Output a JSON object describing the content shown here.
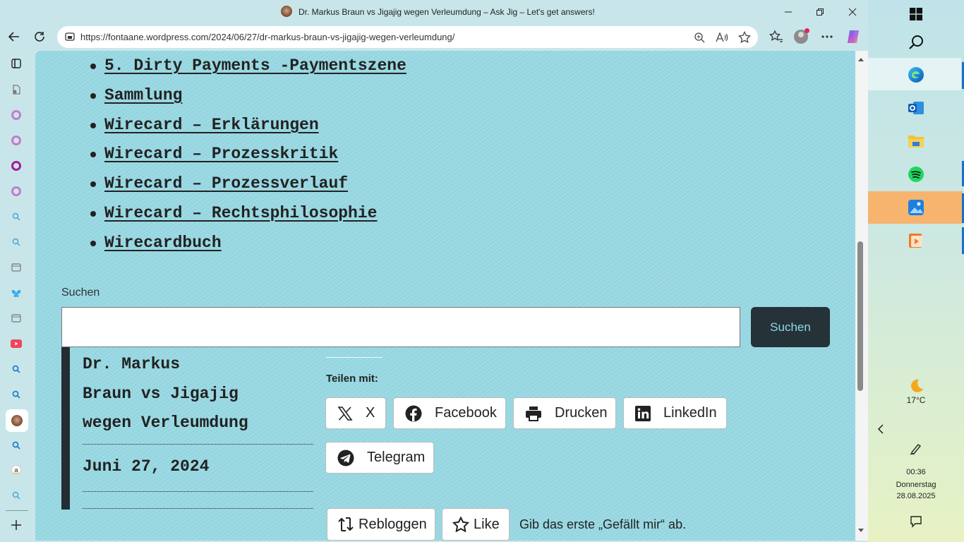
{
  "window": {
    "title": "Dr. Markus Braun vs Jigajig wegen Verleumdung – Ask Jig – Let's get answers!"
  },
  "address_bar": {
    "url": "https://fontaane.wordpress.com/2024/06/27/dr-markus-braun-vs-jigajig-wegen-verleumdung/"
  },
  "categories": [
    "5. Dirty Payments -Paymentszene",
    "Sammlung",
    "Wirecard – Erklärungen",
    "Wirecard – Prozesskritik",
    "Wirecard – Prozessverlauf",
    "Wirecard – Rechtsphilosophie",
    "Wirecardbuch"
  ],
  "search": {
    "label": "Suchen",
    "value": "",
    "button_label": "Suchen"
  },
  "post": {
    "title_lines": [
      "Dr. Markus",
      "Braun vs Jigajig",
      "wegen Verleumdung"
    ],
    "date": "Juni 27, 2024"
  },
  "share": {
    "heading": "Teilen mit:",
    "buttons": [
      {
        "label": "X",
        "icon": "x-logo-icon"
      },
      {
        "label": "Facebook",
        "icon": "facebook-icon"
      },
      {
        "label": "Drucken",
        "icon": "printer-icon"
      },
      {
        "label": "LinkedIn",
        "icon": "linkedin-icon"
      },
      {
        "label": "Telegram",
        "icon": "telegram-icon"
      }
    ]
  },
  "actions": {
    "reblog_label": "Rebloggen",
    "like_label": "Like",
    "like_text": "Gib das erste „Gefällt mir“ ab."
  },
  "taskbar": {
    "weather_temp": "17°C",
    "time": "00:36",
    "day": "Donnerstag",
    "date": "28.08.2025"
  },
  "colors": {
    "page_background": "#98d8e2",
    "chrome_background": "#c8e6ea",
    "search_button_bg": "#253238",
    "search_button_text": "#8dd9e6",
    "accent_dark": "#222e33"
  }
}
